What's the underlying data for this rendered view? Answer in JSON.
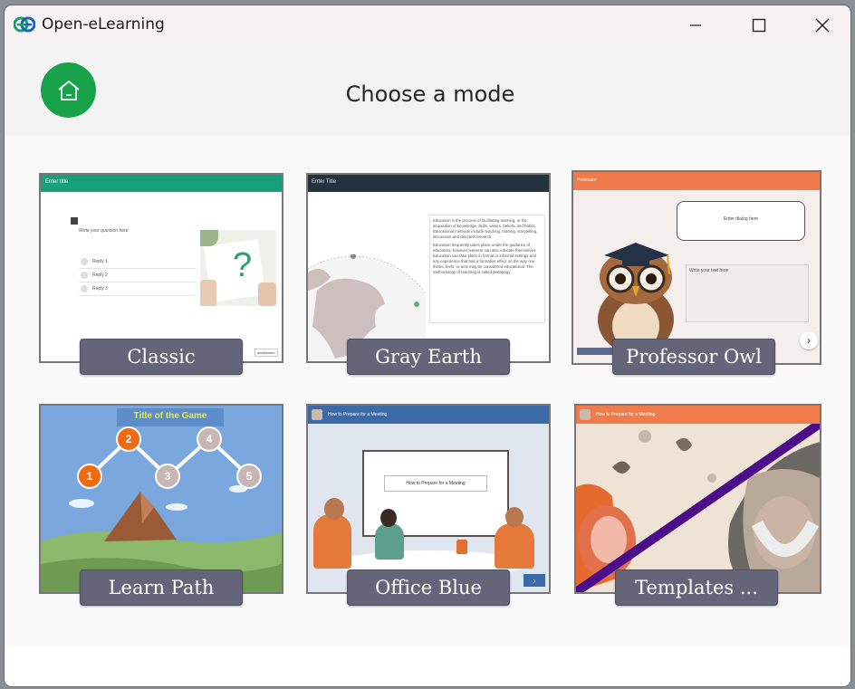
{
  "window": {
    "title": "Open-eLearning"
  },
  "header": {
    "title": "Choose a mode"
  },
  "modes": [
    {
      "label": "Classic",
      "preview": {
        "title": "Enter title",
        "question": "Write your question here",
        "replies": [
          "Reply 1",
          "Reply 2",
          "Reply 3"
        ],
        "button": "addduction"
      }
    },
    {
      "label": "Gray Earth",
      "preview": {
        "title": "Enter Title",
        "paragraph1": "Education is the process of facilitating learning, or the acquisition of knowledge, skills, values, beliefs, and habits. Educational methods include teaching, training, storytelling, discussion and directed research.",
        "paragraph2": "Education frequently takes place under the guidance of educators, however learners can also educate themselves. Education can take place in formal or informal settings and any experience that has a formative effect on the way one thinks, feels, or acts may be considered educational. The methodology of teaching is called pedagogy."
      }
    },
    {
      "label": "Professor Owl",
      "preview": {
        "title": "Professor",
        "dialog": "Enter dialog here",
        "text": "Write your text here"
      }
    },
    {
      "label": "Learn Path",
      "preview": {
        "title": "Title of the Game",
        "steps": [
          "1",
          "2",
          "3",
          "4",
          "5"
        ]
      }
    },
    {
      "label": "Office Blue",
      "preview": {
        "title": "How to Prepare for a Meeting",
        "screen_text": "How to Prepare for a Meeting"
      }
    },
    {
      "label": "Templates ...",
      "preview": {
        "title": "How to Prepare for a Meeting"
      }
    }
  ],
  "colors": {
    "home_button": "#18a34a",
    "label_bg": "#646578",
    "classic_bar": "#17a07a",
    "grayearth_bar": "#243240",
    "owl_bar": "#f07a4a",
    "office_bar": "#3a6aa8",
    "templates_bar": "#f07c4c",
    "templates_stripe": "#4b0e8a"
  },
  "icons": {
    "app": "open-elearning-logo",
    "home": "home-icon",
    "minimize": "minimize-icon",
    "maximize": "maximize-icon",
    "close": "close-icon"
  }
}
